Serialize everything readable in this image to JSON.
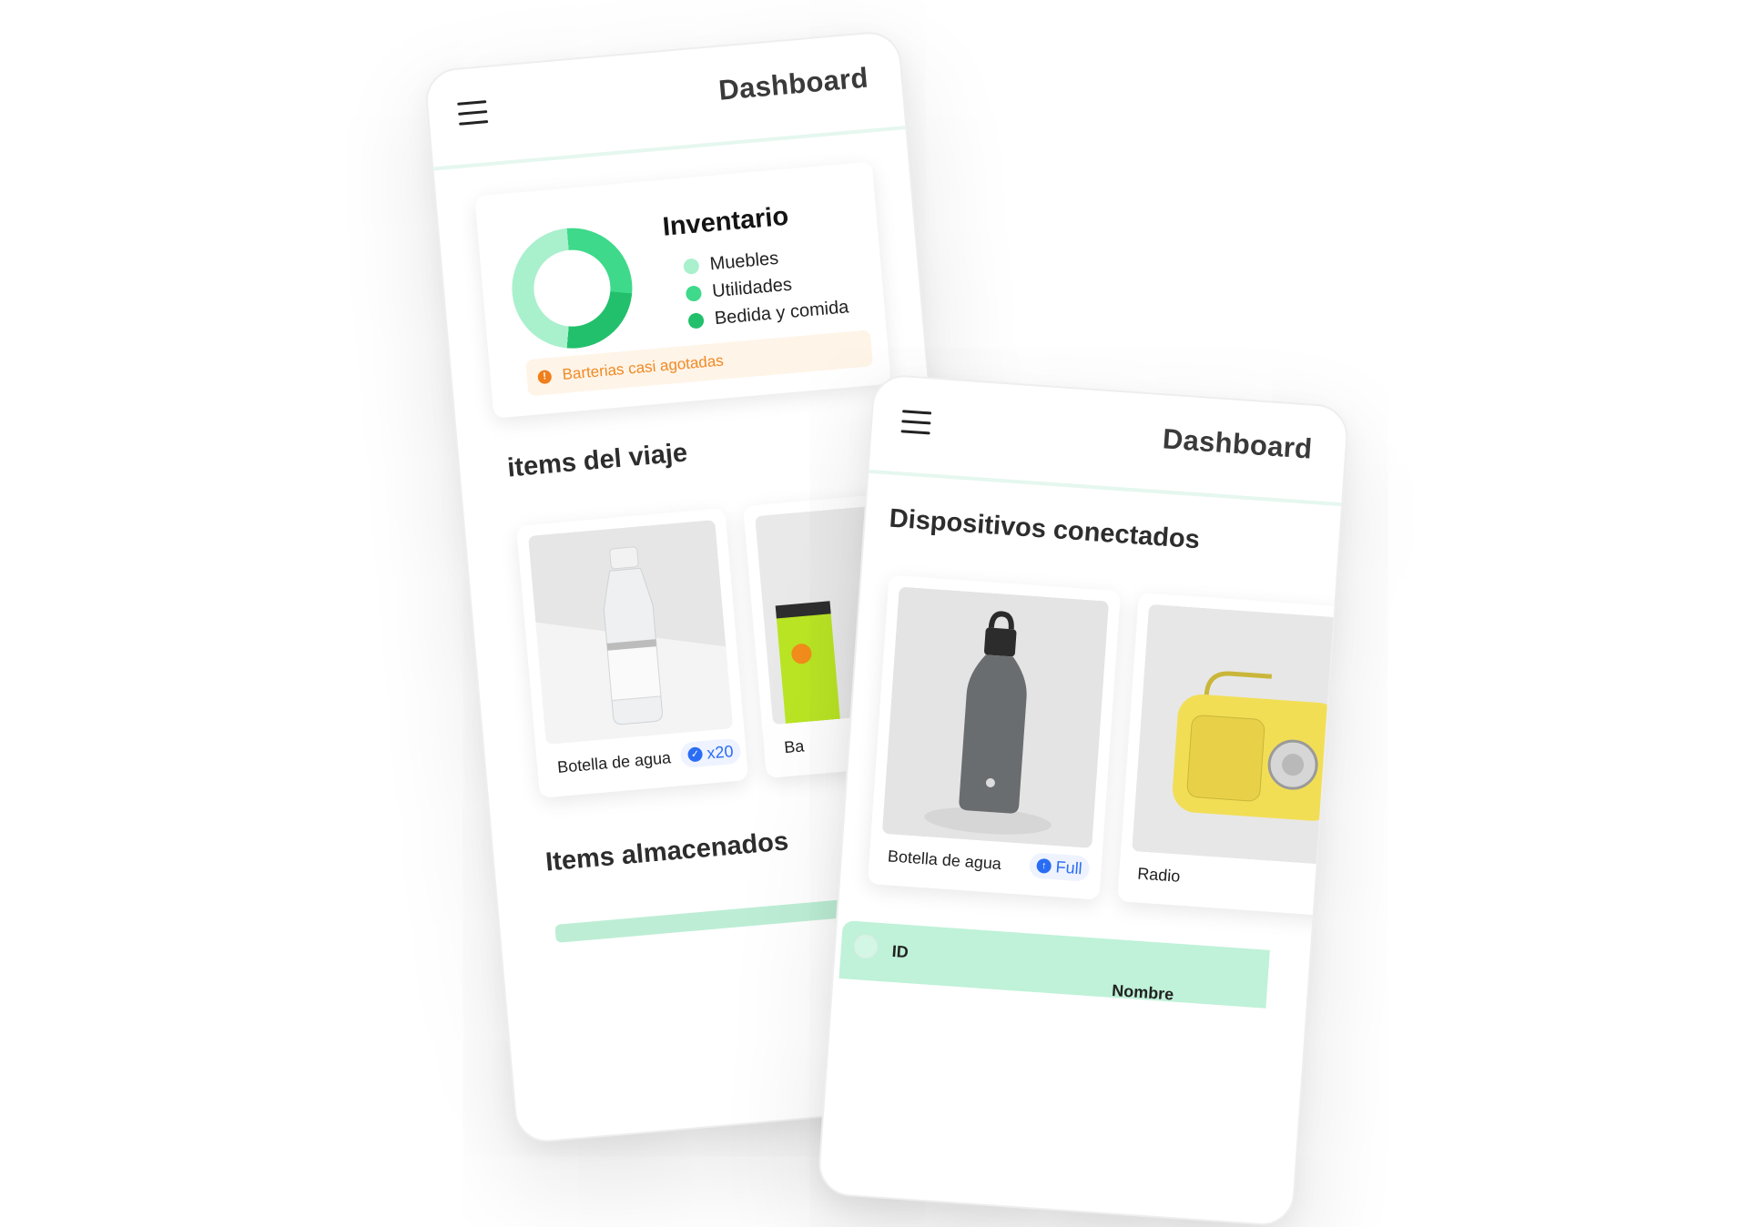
{
  "colors": {
    "accent": "#2ecc7a",
    "mint_light": "#a9f0cc",
    "mint_mid": "#3ed98a",
    "green_dark": "#22c06c",
    "alert_bg": "#fff4e8",
    "alert_text": "#f08a25",
    "badge_blue": "#2a6df4"
  },
  "phone_left": {
    "header": {
      "title": "Dashboard",
      "menu_icon": "hamburger-menu-icon"
    },
    "inventory": {
      "title": "Inventario",
      "legend": [
        {
          "label": "Muebles",
          "color": "#a9f0cc"
        },
        {
          "label": "Utilidades",
          "color": "#3ed98a"
        },
        {
          "label": "Bedida y comida",
          "color": "#22c06c"
        }
      ],
      "alert": {
        "text": "Barterias casi agotadas",
        "icon": "alert-circle-icon"
      }
    },
    "trip_items": {
      "title": "items del viaje",
      "cards": [
        {
          "name": "Botella de agua",
          "badge": "x20",
          "badge_icon": "check-circle-icon"
        },
        {
          "name": "Ba"
        }
      ]
    },
    "stored_items": {
      "title": "Items almacenados"
    }
  },
  "phone_right": {
    "header": {
      "title": "Dashboard",
      "menu_icon": "hamburger-menu-icon"
    },
    "devices": {
      "title": "Dispositivos conectados",
      "cards": [
        {
          "name": "Botella de agua",
          "badge": "Full",
          "badge_icon": "arrow-up-circle-icon"
        },
        {
          "name": "Radio"
        }
      ]
    },
    "table": {
      "columns": [
        "ID",
        "Nombre"
      ]
    }
  }
}
